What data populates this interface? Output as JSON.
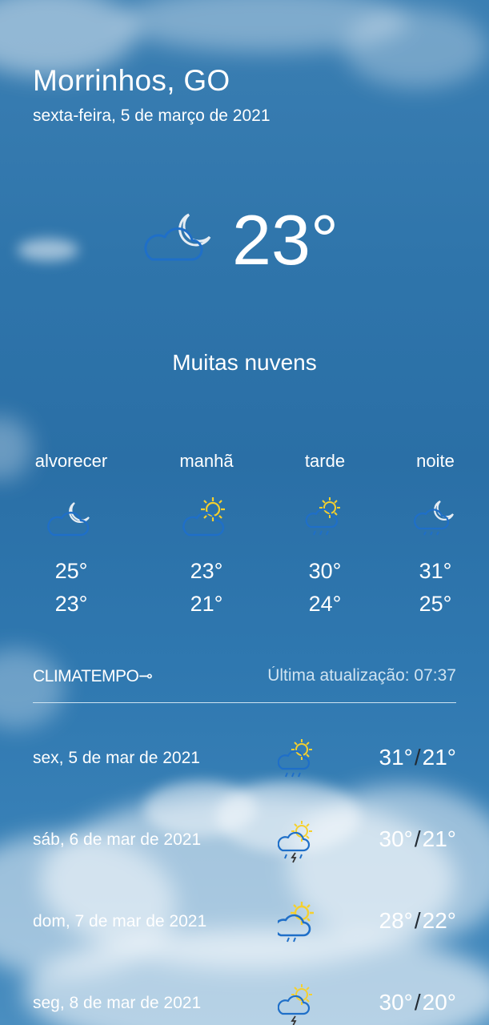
{
  "location": {
    "city": "Morrinhos, GO",
    "date": "sexta-feira, 5 de março de 2021"
  },
  "current": {
    "temperature": "23°",
    "condition": "Muitas nuvens",
    "icon": "moon-cloud-icon"
  },
  "periods": [
    {
      "label": "alvorecer",
      "max": "25°",
      "min": "23°",
      "icon": "moon-cloud-icon"
    },
    {
      "label": "manhã",
      "max": "23°",
      "min": "21°",
      "icon": "sun-cloud-icon"
    },
    {
      "label": "tarde",
      "max": "30°",
      "min": "24°",
      "icon": "sun-cloud-rain-icon"
    },
    {
      "label": "noite",
      "max": "31°",
      "min": "25°",
      "icon": "moon-cloud-rain-icon"
    }
  ],
  "source": {
    "brand": "CLIMATEMPO",
    "updated_label": "Última atualização: 07:37"
  },
  "daily": [
    {
      "date": "sex, 5 de mar de 2021",
      "max": "31°",
      "min": "21°",
      "icon": "sun-cloud-rain-icon"
    },
    {
      "date": "sáb, 6 de mar de 2021",
      "max": "30°",
      "min": "21°",
      "icon": "sun-cloud-storm-icon"
    },
    {
      "date": "dom, 7 de mar de 2021",
      "max": "28°",
      "min": "22°",
      "icon": "sun-cloud-rain-icon"
    },
    {
      "date": "seg, 8 de mar de 2021",
      "max": "30°",
      "min": "20°",
      "icon": "sun-cloud-storm-icon"
    }
  ],
  "colors": {
    "icon_blue": "#1f6fc8",
    "sun_yellow": "#f5d02e",
    "moon_white": "#e6edf3"
  }
}
